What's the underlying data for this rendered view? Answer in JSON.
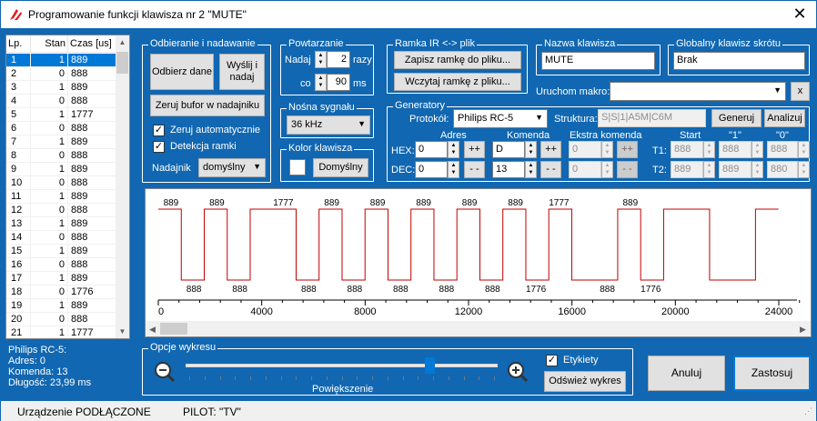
{
  "window": {
    "title": "Programowanie funkcji klawisza nr 2 \"MUTE\"",
    "close": "✕"
  },
  "table": {
    "headers": [
      "Lp.",
      "Stan",
      "Czas [us]"
    ],
    "rows": [
      [
        "1",
        "1",
        "889"
      ],
      [
        "2",
        "0",
        "888"
      ],
      [
        "3",
        "1",
        "889"
      ],
      [
        "4",
        "0",
        "888"
      ],
      [
        "5",
        "1",
        "1777"
      ],
      [
        "6",
        "0",
        "888"
      ],
      [
        "7",
        "1",
        "889"
      ],
      [
        "8",
        "0",
        "888"
      ],
      [
        "9",
        "1",
        "889"
      ],
      [
        "10",
        "0",
        "888"
      ],
      [
        "11",
        "1",
        "889"
      ],
      [
        "12",
        "0",
        "888"
      ],
      [
        "13",
        "1",
        "889"
      ],
      [
        "14",
        "0",
        "888"
      ],
      [
        "15",
        "1",
        "889"
      ],
      [
        "16",
        "0",
        "888"
      ],
      [
        "17",
        "1",
        "889"
      ],
      [
        "18",
        "0",
        "1776"
      ],
      [
        "19",
        "1",
        "889"
      ],
      [
        "20",
        "0",
        "888"
      ],
      [
        "21",
        "1",
        "1777"
      ]
    ]
  },
  "info": {
    "line1": "Philips RC-5:",
    "line2": "Adres: 0",
    "line3": "Komenda: 13",
    "line4": "Długość: 23,99 ms"
  },
  "recv": {
    "legend": "Odbieranie i nadawanie",
    "receive": "Odbierz dane",
    "sendrecv": "Wyślij i nadaj",
    "clear": "Zeruj bufor w nadajniku",
    "auto_clear": "Zeruj automatycznie",
    "frame_detect": "Detekcja ramki",
    "transmitter_label": "Nadajnik",
    "transmitter_value": "domyślny"
  },
  "repeat": {
    "legend": "Powtarzanie",
    "send_label": "Nadaj",
    "send_value": "2",
    "times": "razy",
    "every_label": "co",
    "every_value": "90",
    "ms": "ms"
  },
  "carrier": {
    "legend": "Nośna sygnału",
    "value": "36 kHz"
  },
  "color": {
    "legend": "Kolor klawisza",
    "default": "Domyślny"
  },
  "frame": {
    "legend": "Ramka IR <-> plik",
    "save": "Zapisz ramkę do pliku...",
    "load": "Wczytaj ramkę z pliku..."
  },
  "keyname": {
    "legend": "Nazwa klawisza",
    "value": "MUTE"
  },
  "global": {
    "legend": "Globalny klawisz skrótu",
    "value": "Brak"
  },
  "macro": {
    "label": "Uruchom makro:",
    "value": "",
    "clear": "x"
  },
  "gen": {
    "legend": "Generatory",
    "protocol_label": "Protokół:",
    "protocol": "Philips RC-5",
    "structure_label": "Struktura:",
    "structure": "S|S|1|A5M|C6M",
    "generate": "Generuj",
    "analyze": "Analizuj",
    "addr_label": "Adres",
    "cmd_label": "Komenda",
    "extra_label": "Ekstra komenda",
    "hex": "HEX:",
    "dec": "DEC:",
    "addr_hex": "0",
    "addr_dec": "0",
    "cmd_hex": "D",
    "cmd_dec": "13",
    "extra_hex": "0",
    "extra_dec": "0",
    "inc": "++",
    "dec_btn": "- -",
    "start_label": "Start",
    "one_label": "\"1\"",
    "zero_label": "\"0\"",
    "t1": "T1:",
    "t2": "T2:",
    "t1_start": "888",
    "t1_one": "888",
    "t1_zero": "888",
    "t2_start": "889",
    "t2_one": "889",
    "t2_zero": "880"
  },
  "plot": {
    "legend": "Opcje wykresu",
    "zoom": "Powiększenie",
    "labels": "Etykiety",
    "refresh": "Odśwież wykres",
    "zoom_level": 0.78
  },
  "actions": {
    "cancel": "Anuluj",
    "apply": "Zastosuj"
  },
  "status": {
    "device": "Urządzenie PODŁĄCZONE",
    "remote": "PILOT: \"TV\""
  },
  "chart_data": {
    "type": "line",
    "x_ticks": [
      "0",
      "4000",
      "8000",
      "12000",
      "16000",
      "20000",
      "24000"
    ],
    "xlim": [
      0,
      24000
    ],
    "segments": [
      [
        1,
        889
      ],
      [
        0,
        888
      ],
      [
        1,
        889
      ],
      [
        0,
        888
      ],
      [
        1,
        1777
      ],
      [
        0,
        888
      ],
      [
        1,
        889
      ],
      [
        0,
        888
      ],
      [
        1,
        889
      ],
      [
        0,
        888
      ],
      [
        1,
        889
      ],
      [
        0,
        888
      ],
      [
        1,
        889
      ],
      [
        0,
        888
      ],
      [
        1,
        889
      ],
      [
        0,
        888
      ],
      [
        1,
        889
      ],
      [
        0,
        1776
      ],
      [
        1,
        889
      ],
      [
        0,
        888
      ],
      [
        1,
        1777
      ],
      [
        0,
        1776
      ],
      [
        1,
        889
      ]
    ],
    "high_labels": [
      "889",
      "889",
      "1777",
      "889",
      "889",
      "889",
      "889",
      "889",
      "1777",
      "889"
    ],
    "low_labels": [
      "888",
      "888",
      "888",
      "888",
      "888",
      "888",
      "888",
      "1776",
      "888",
      "1776"
    ]
  }
}
